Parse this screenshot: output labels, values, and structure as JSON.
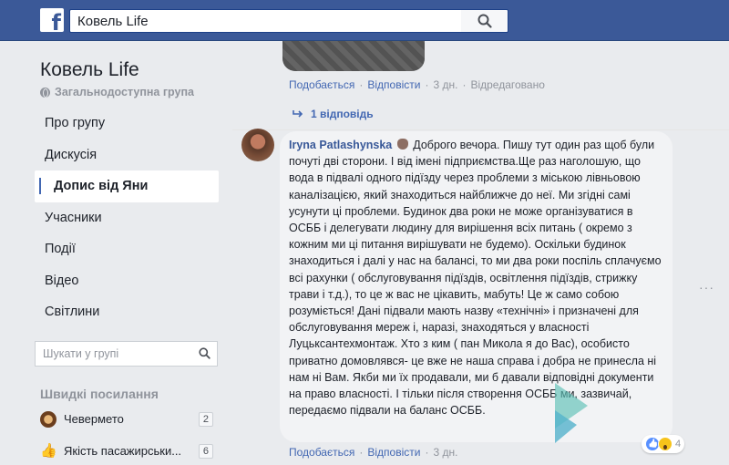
{
  "topbar": {
    "logo": "f",
    "search_value": "Ковель Life",
    "search_icon": "search-icon"
  },
  "sidebar": {
    "group_name": "Ковель Life",
    "group_type": "Загальнодоступна група",
    "items": [
      {
        "label": "Про групу"
      },
      {
        "label": "Дискусія"
      },
      {
        "label": "Допис від Яни"
      },
      {
        "label": "Учасники"
      },
      {
        "label": "Події"
      },
      {
        "label": "Відео"
      },
      {
        "label": "Світлини"
      }
    ],
    "search_placeholder": "Шукати у групі",
    "shortcuts_title": "Швидкі посилання",
    "shortcuts": [
      {
        "label": "Чевермето",
        "count": "2"
      },
      {
        "label": "Якість пасажирськи...",
        "count": "6"
      }
    ]
  },
  "feed": {
    "prev_comment": {
      "like": "Подобається",
      "reply": "Відповісти",
      "time": "3 дн.",
      "edited": "Відредаговано"
    },
    "replies_label": "1 відповідь",
    "comment": {
      "author": "Iryna Patlashynska",
      "text": "Доброго вечора. Пишу тут один раз щоб були почуті дві сторони. І від імені підприємства.Ще раз наголошую, що вода в підвалі одного підїзду через проблеми з міською лівньовою каналізацією, який знаходиться найближче до неї. Ми згідні самі усунути ці проблеми. Будинок два роки не може організуватися в ОСББ і делегувати людину для вирішення всіх питань ( окремо з кожним ми ці питання вирішувати не будемо). Оскільки будинок знаходиться і далі у нас на балансі, то ми два роки поспіль сплачуємо всі рахунки ( обслуговування підїздів, освітлення підїздів, стрижку трави і т.д.), то це ж вас не цікавить, мабуть! Це ж само собою розуміється! Дані підвали мають назву «технічні» і призначені для обслуговування мереж і, наразі, знаходяться у власності Луцьксантехмонтаж. Хто з ким ( пан Микола я до Вас), особисто приватно домовлявся- це вже не наша справа і добра не принесла ні нам ні Вам. Якби ми їх продавали, ми б давали відповідні документи на право власності. І тільки після створення ОСББ ми, зазвичай, передаємо підвали на баланс ОСББ.",
      "like": "Подобається",
      "reply": "Відповісти",
      "time": "3 дн.",
      "reactions_count": "4"
    },
    "more": "···"
  },
  "colors": {
    "topbar": "#3b5998",
    "link": "#4267b2",
    "author": "#385898",
    "muted": "#90949c",
    "page_bg": "#e9ebee",
    "bubble": "#f2f3f5"
  }
}
